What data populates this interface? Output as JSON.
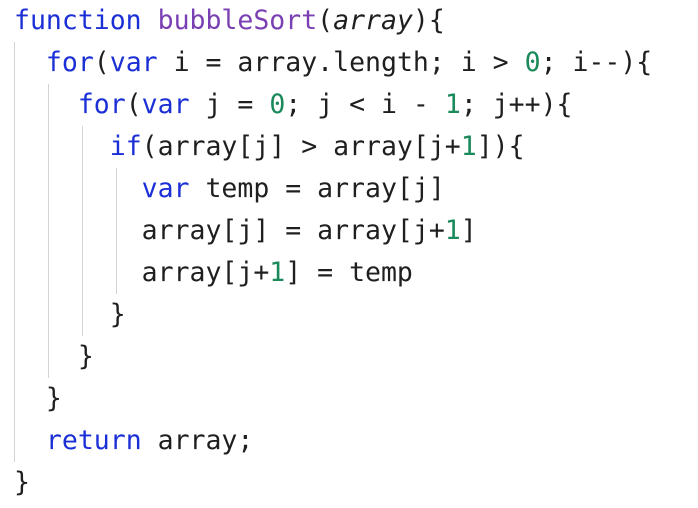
{
  "colors": {
    "keyword": "#1b2fd6",
    "function_name": "#7a3fb2",
    "number": "#1a8a5a",
    "text": "#1f1f1f",
    "indent_guide": "#d4d4d4",
    "background": "#ffffff"
  },
  "code": {
    "lines": [
      [
        {
          "t": "function",
          "k": "kw"
        },
        {
          "t": " ",
          "k": "plain"
        },
        {
          "t": "bubbleSort",
          "k": "fn"
        },
        {
          "t": "(",
          "k": "plain"
        },
        {
          "t": "array",
          "k": "param"
        },
        {
          "t": "){",
          "k": "plain"
        }
      ],
      [
        {
          "t": "  ",
          "k": "plain"
        },
        {
          "t": "for",
          "k": "kw"
        },
        {
          "t": "(",
          "k": "plain"
        },
        {
          "t": "var",
          "k": "kw"
        },
        {
          "t": " i = array.length; i > ",
          "k": "plain"
        },
        {
          "t": "0",
          "k": "num"
        },
        {
          "t": "; i--){",
          "k": "plain"
        }
      ],
      [
        {
          "t": "    ",
          "k": "plain"
        },
        {
          "t": "for",
          "k": "kw"
        },
        {
          "t": "(",
          "k": "plain"
        },
        {
          "t": "var",
          "k": "kw"
        },
        {
          "t": " j = ",
          "k": "plain"
        },
        {
          "t": "0",
          "k": "num"
        },
        {
          "t": "; j < i - ",
          "k": "plain"
        },
        {
          "t": "1",
          "k": "num"
        },
        {
          "t": "; j++){",
          "k": "plain"
        }
      ],
      [
        {
          "t": "      ",
          "k": "plain"
        },
        {
          "t": "if",
          "k": "kw"
        },
        {
          "t": "(array[j] > array[j+",
          "k": "plain"
        },
        {
          "t": "1",
          "k": "num"
        },
        {
          "t": "]){",
          "k": "plain"
        }
      ],
      [
        {
          "t": "        ",
          "k": "plain"
        },
        {
          "t": "var",
          "k": "kw"
        },
        {
          "t": " temp = array[j]",
          "k": "plain"
        }
      ],
      [
        {
          "t": "        array[j] = array[j+",
          "k": "plain"
        },
        {
          "t": "1",
          "k": "num"
        },
        {
          "t": "]",
          "k": "plain"
        }
      ],
      [
        {
          "t": "        array[j+",
          "k": "plain"
        },
        {
          "t": "1",
          "k": "num"
        },
        {
          "t": "] = temp",
          "k": "plain"
        }
      ],
      [
        {
          "t": "      }",
          "k": "plain"
        }
      ],
      [
        {
          "t": "    }",
          "k": "plain"
        }
      ],
      [
        {
          "t": "  }",
          "k": "plain"
        }
      ],
      [
        {
          "t": "  ",
          "k": "plain"
        },
        {
          "t": "return",
          "k": "kw"
        },
        {
          "t": " array;",
          "k": "plain"
        }
      ],
      [
        {
          "t": "}",
          "k": "plain"
        }
      ]
    ]
  }
}
